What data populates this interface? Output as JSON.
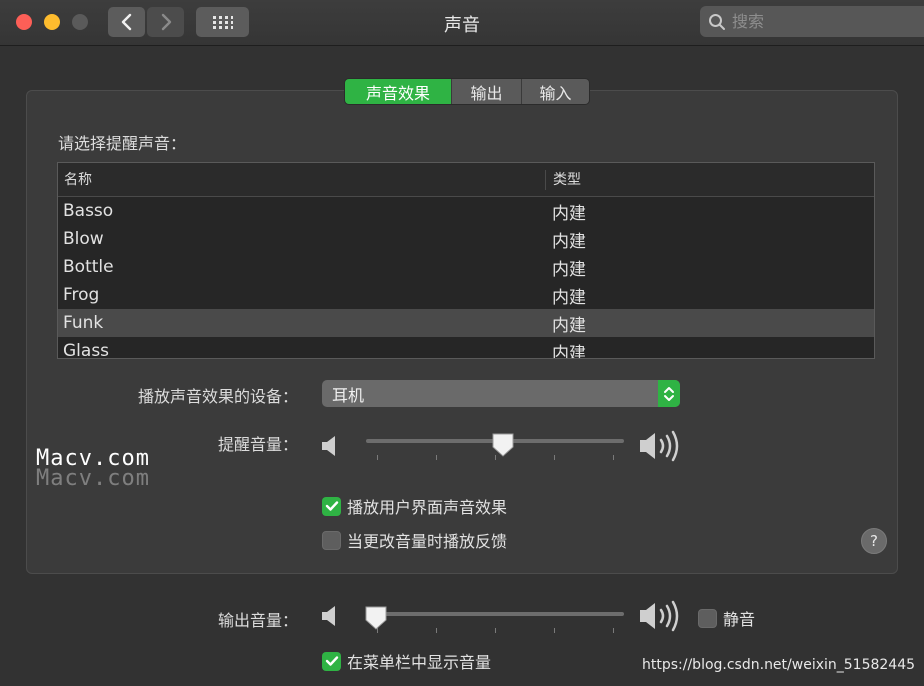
{
  "window": {
    "title": "声音"
  },
  "search": {
    "placeholder": "搜索"
  },
  "tabs": [
    {
      "label": "声音效果",
      "active": true
    },
    {
      "label": "输出",
      "active": false
    },
    {
      "label": "输入",
      "active": false
    }
  ],
  "alert_section": {
    "label": "请选择提醒声音：",
    "columns": {
      "name": "名称",
      "type": "类型"
    },
    "rows": [
      {
        "name": "Basso",
        "type": "内建",
        "selected": false
      },
      {
        "name": "Blow",
        "type": "内建",
        "selected": false
      },
      {
        "name": "Bottle",
        "type": "内建",
        "selected": false
      },
      {
        "name": "Frog",
        "type": "内建",
        "selected": false
      },
      {
        "name": "Funk",
        "type": "内建",
        "selected": true
      },
      {
        "name": "Glass",
        "type": "内建",
        "selected": false
      }
    ]
  },
  "device": {
    "label": "播放声音效果的设备：",
    "value": "耳机"
  },
  "alert_volume": {
    "label": "提醒音量：",
    "level": 0.53
  },
  "checkboxes": {
    "ui_effects": {
      "label": "播放用户界面声音效果",
      "checked": true
    },
    "volume_feedback": {
      "label": "当更改音量时播放反馈",
      "checked": false
    }
  },
  "output_volume": {
    "label": "输出音量：",
    "level": 0.04
  },
  "mute": {
    "label": "静音",
    "checked": false
  },
  "menubar": {
    "label": "在菜单栏中显示音量",
    "checked": true
  },
  "help": {
    "label": "?"
  },
  "watermark": {
    "line1": "Macv.com",
    "line2": "Macv.com",
    "url": "https://blog.csdn.net/weixin_51582445"
  },
  "colors": {
    "accent": "#2fb344",
    "background": "#323232"
  },
  "icons": {
    "back": "chevron-left-icon",
    "forward": "chevron-right-icon",
    "grid": "grid-icon",
    "search": "search-icon",
    "speaker_low": "speaker-low-icon",
    "speaker_high": "speaker-high-icon",
    "checkmark": "checkmark-icon",
    "select_arrows": "up-down-arrows-icon"
  }
}
